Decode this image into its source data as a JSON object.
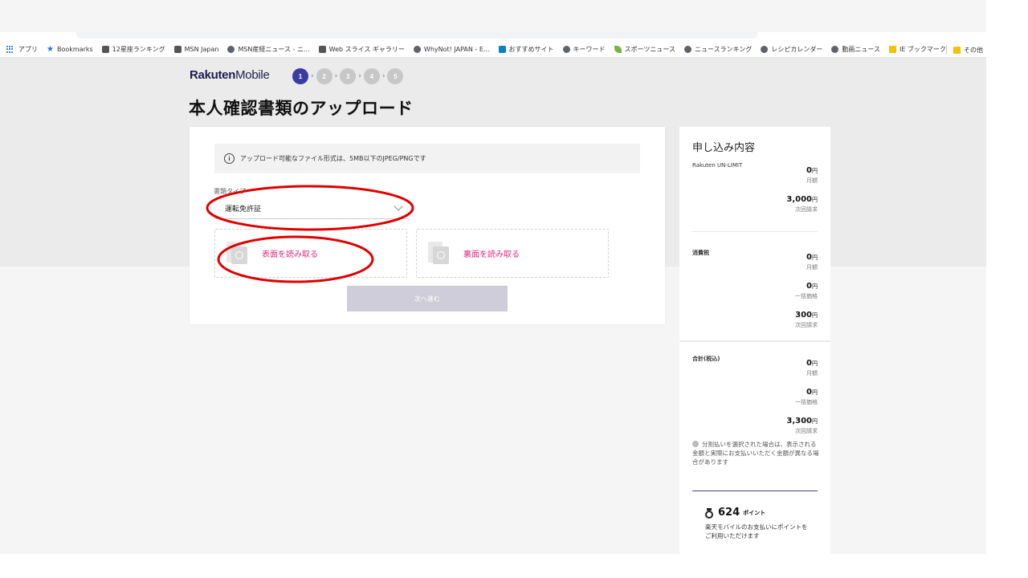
{
  "browser": {
    "bookmarks": [
      {
        "label": "アプリ",
        "icon": "apps-grid-icon"
      },
      {
        "label": "Bookmarks",
        "icon": "star-icon"
      },
      {
        "label": "12星座ランキング",
        "icon": "msn-icon"
      },
      {
        "label": "MSN Japan",
        "icon": "msn-icon"
      },
      {
        "label": "MSN産経ニュース - ニ...",
        "icon": "globe-icon"
      },
      {
        "label": "Web スライス ギャラリー",
        "icon": "msn-icon"
      },
      {
        "label": "WhyNot! JAPAN - E...",
        "icon": "globe-icon"
      },
      {
        "label": "おすすめサイト",
        "icon": "bing-icon"
      },
      {
        "label": "キーワード",
        "icon": "globe-icon"
      },
      {
        "label": "スポーツニュース",
        "icon": "leaf-icon"
      },
      {
        "label": "ニュースランキング",
        "icon": "globe-icon"
      },
      {
        "label": "レシピカレンダー",
        "icon": "globe-icon"
      },
      {
        "label": "動画ニュース",
        "icon": "globe-icon"
      },
      {
        "label": "IE ブックマーク",
        "icon": "folder-icon"
      }
    ],
    "other_bookmarks": "その他"
  },
  "header": {
    "brand_bold": "Rakuten",
    "brand_light": "Mobile",
    "steps": [
      "1",
      "2",
      "3",
      "4",
      "5"
    ],
    "active_step": 1,
    "title": "本人確認書類のアップロード"
  },
  "form": {
    "info_icon": "i",
    "info_text": "アップロード可能なファイル形式は、5MB以下のJPEG/PNGです",
    "doc_type_label": "書類タイプ",
    "doc_type_value": "運転免許証",
    "front_label": "表面を読み取る",
    "back_label": "裏面を読み取る",
    "next_label": "次へ進む"
  },
  "summary": {
    "title": "申し込み内容",
    "plan": {
      "name": "Rakuten UN-LIMIT",
      "monthly_value": "0",
      "monthly_sub": "月額",
      "next_value": "3,000",
      "next_sub": "次回請求"
    },
    "tax": {
      "name": "消費税",
      "monthly_value": "0",
      "monthly_sub": "月額",
      "lump_value": "0",
      "lump_sub": "一括価格",
      "next_value": "300",
      "next_sub": "次回請求"
    },
    "total": {
      "name": "合計(税込)",
      "monthly_value": "0",
      "monthly_sub": "月額",
      "lump_value": "0",
      "lump_sub": "一括価格",
      "next_value": "3,300",
      "next_sub": "次回請求"
    },
    "yen": "円",
    "note": "分割払いを選択された場合は、表示される金額と実際にお支払いいただく金額が異なる場合があります",
    "points_value": "624",
    "points_unit": "ポイント",
    "points_desc": "楽天モバイルのお支払いにポイントをご利用いただけます"
  },
  "colors": {
    "accent_step": "#3b3ba5",
    "pink_link": "#e0297d",
    "annotation_red": "#e00000"
  }
}
